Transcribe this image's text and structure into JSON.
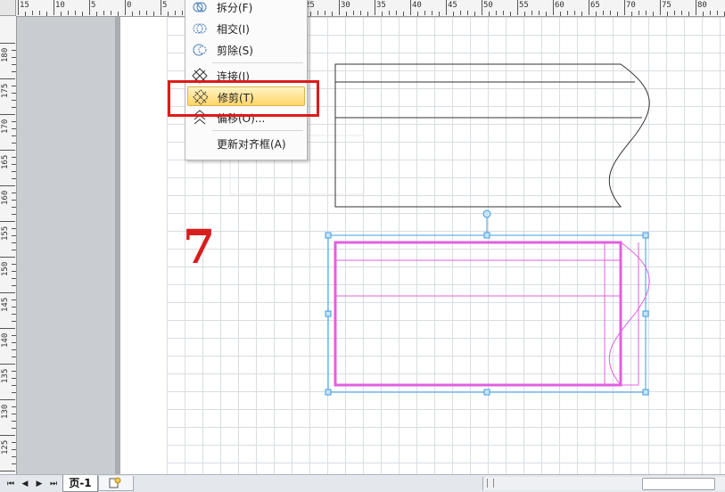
{
  "ruler_top_labels": [
    "15",
    "10",
    "5",
    "0",
    "5",
    "10",
    "15",
    "20",
    "25",
    "30",
    "35",
    "40",
    "45",
    "50",
    "55",
    "60",
    "65",
    "70",
    "75",
    "80"
  ],
  "ruler_left_labels": [
    "180",
    "175",
    "170",
    "165",
    "160",
    "155",
    "150",
    "145",
    "140",
    "135",
    "130",
    "125",
    "120"
  ],
  "context_menu": {
    "items": [
      {
        "label": "拆分(F)",
        "icon": "split-icon"
      },
      {
        "label": "相交(I)",
        "icon": "intersect-icon"
      },
      {
        "label": "剪除(S)",
        "icon": "subtract-icon"
      },
      {
        "label": "连接(J)",
        "icon": "join-icon"
      },
      {
        "label": "修剪(T)",
        "icon": "trim-icon",
        "active": true
      },
      {
        "label": "偏移(O)...",
        "icon": "offset-icon"
      },
      {
        "label": "更新对齐框(A)",
        "icon": ""
      }
    ]
  },
  "step_number": "7",
  "page_tab_label": "页-1",
  "colors": {
    "selection": "#e060e0",
    "highlight": "#e01a1a",
    "handle": "#3c9be0",
    "step_number": "#d91c1c"
  }
}
